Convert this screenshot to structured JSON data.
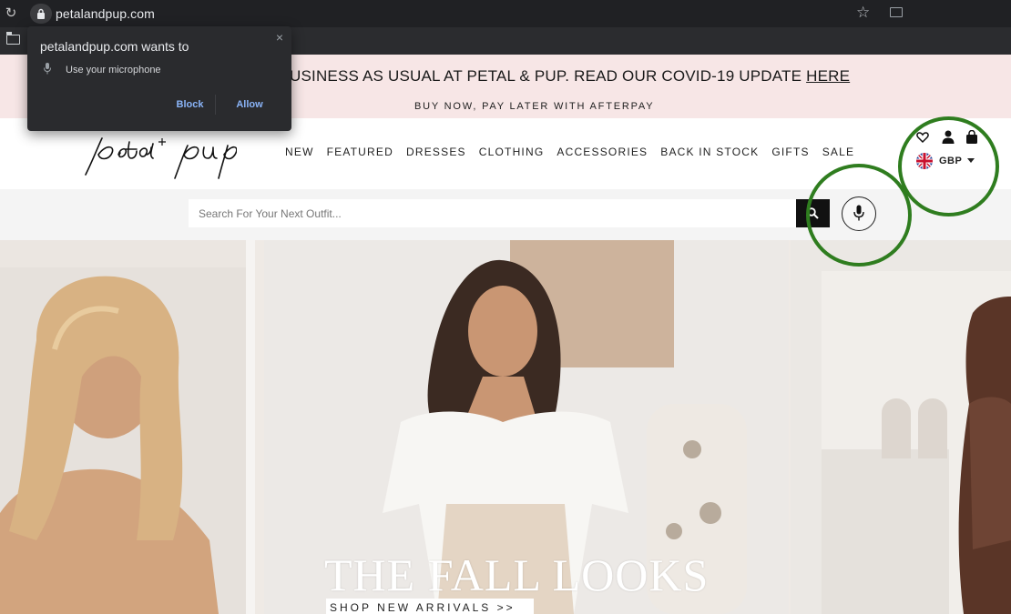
{
  "browser": {
    "url": "petalandpup.com",
    "icons": [
      "reload-icon",
      "lock-icon",
      "star-icon",
      "cast-icon",
      "folder-icon"
    ]
  },
  "permission_popup": {
    "title": "petalandpup.com wants to",
    "item": "Use your microphone",
    "block_label": "Block",
    "allow_label": "Allow",
    "close_glyph": "×"
  },
  "promo": {
    "line1": "USINESS AS USUAL AT PETAL & PUP. READ OUR COVID-19 UPDATE ",
    "line1_link": "HERE",
    "line2": "BUY NOW, PAY LATER WITH AFTERPAY"
  },
  "header": {
    "logo_text": "petal + pup",
    "nav": [
      "NEW",
      "FEATURED",
      "DRESSES",
      "CLOTHING",
      "ACCESSORIES",
      "BACK IN STOCK",
      "GIFTS",
      "SALE"
    ],
    "currency": "GBP"
  },
  "search": {
    "placeholder": "Search For Your Next Outfit..."
  },
  "hero": {
    "title": "THE FALL LOOKS",
    "cta": "SHOP NEW ARRIVALS >>"
  },
  "colors": {
    "promo_bg": "#f7e6e6",
    "annotation": "#2f7d1f",
    "popup_bg": "#2a2b2e",
    "popup_button": "#8ab4f8"
  }
}
